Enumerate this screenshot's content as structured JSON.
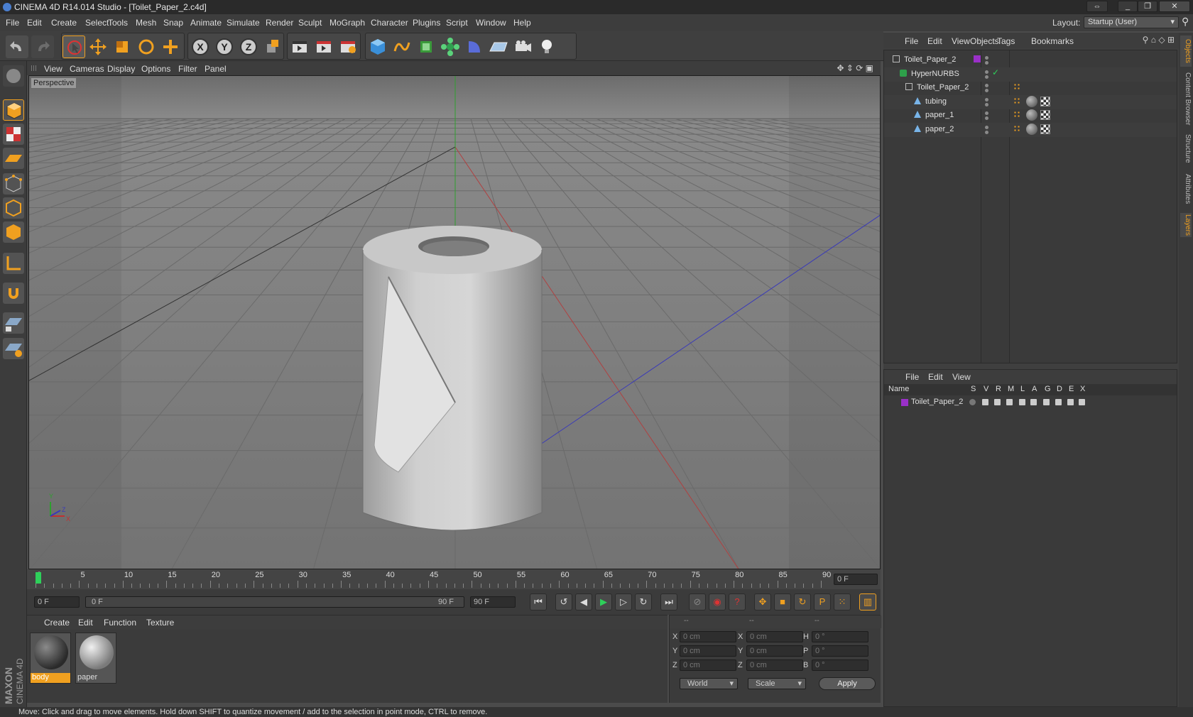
{
  "window": {
    "title": "CINEMA 4D R14.014 Studio - [Toilet_Paper_2.c4d]"
  },
  "menubar": {
    "items": [
      "File",
      "Edit",
      "Create",
      "Select",
      "Tools",
      "Mesh",
      "Snap",
      "Animate",
      "Simulate",
      "Render",
      "Sculpt",
      "MoGraph",
      "Character",
      "Plugins",
      "Script",
      "Window",
      "Help"
    ]
  },
  "layout": {
    "label": "Layout:",
    "value": "Startup (User)"
  },
  "viewport": {
    "menu": [
      "View",
      "Cameras",
      "Display",
      "Options",
      "Filter",
      "Panel"
    ],
    "label": "Perspective",
    "axes": {
      "y": "Y",
      "x": "X",
      "z": "Z"
    }
  },
  "timeline": {
    "ticks": [
      "0",
      "5",
      "10",
      "15",
      "20",
      "25",
      "30",
      "35",
      "40",
      "45",
      "50",
      "55",
      "60",
      "65",
      "70",
      "75",
      "80",
      "85",
      "90"
    ],
    "current_frame": "0 F"
  },
  "transport": {
    "start": "0 F",
    "range_start": "0 F",
    "range_end": "90 F",
    "end": "90 F"
  },
  "materials": {
    "menu": [
      "Create",
      "Edit",
      "Function",
      "Texture"
    ],
    "items": [
      {
        "name": "body"
      },
      {
        "name": "paper"
      }
    ]
  },
  "coords": {
    "headers": [
      "--",
      "--",
      "--"
    ],
    "rows": [
      {
        "a": "X",
        "av": "0 cm",
        "b": "X",
        "bv": "0 cm",
        "c": "H",
        "cv": "0 °"
      },
      {
        "a": "Y",
        "av": "0 cm",
        "b": "Y",
        "bv": "0 cm",
        "c": "P",
        "cv": "0 °"
      },
      {
        "a": "Z",
        "av": "0 cm",
        "b": "Z",
        "bv": "0 cm",
        "c": "B",
        "cv": "0 °"
      }
    ],
    "space": "World",
    "mode": "Scale",
    "apply": "Apply"
  },
  "objects": {
    "menu": [
      "File",
      "Edit",
      "View",
      "Objects",
      "Tags",
      "Bookmarks"
    ],
    "tree": [
      {
        "name": "Toilet_Paper_2"
      },
      {
        "name": "HyperNURBS"
      },
      {
        "name": "Toilet_Paper_2"
      },
      {
        "name": "tubing"
      },
      {
        "name": "paper_1"
      },
      {
        "name": "paper_2"
      }
    ]
  },
  "layers": {
    "menu": [
      "File",
      "Edit",
      "View"
    ],
    "columns": [
      "Name",
      "S",
      "V",
      "R",
      "M",
      "L",
      "A",
      "G",
      "D",
      "E",
      "X"
    ],
    "rows": [
      {
        "name": "Toilet_Paper_2"
      }
    ]
  },
  "sidetabs": [
    "Objects",
    "Content Browser",
    "Structure",
    "Attributes",
    "Layers"
  ],
  "branding": {
    "line1": "MAXON",
    "line2": "CINEMA 4D"
  },
  "status": "Move: Click and drag to move elements. Hold down SHIFT to quantize movement / add to the selection in point mode, CTRL to remove.",
  "colors": {
    "accent": "#f0a020",
    "layer_purple": "#9a30c8",
    "axis_x": "#c03030",
    "axis_y": "#30a030",
    "axis_z": "#3030c0"
  }
}
